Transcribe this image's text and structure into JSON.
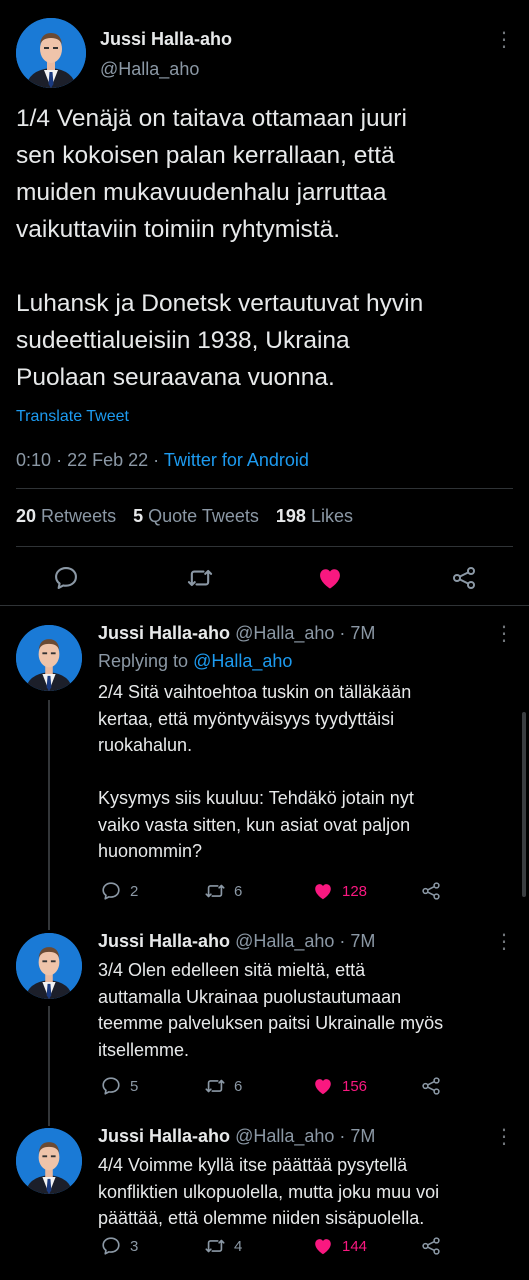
{
  "colors": {
    "background": "#000000",
    "accent": "#1d9bf0",
    "like": "#f91880",
    "muted": "#8b98a5"
  },
  "main_tweet": {
    "author_name": "Jussi Halla-aho",
    "author_handle": "@Halla_aho",
    "text": "1/4 Venäjä on taitava ottamaan juuri\nsen kokoisen palan kerrallaan, että\nmuiden mukavuudenhalu jarruttaa\nvaikuttaviin toimiin ryhtymistä.\n\nLuhansk ja Donetsk vertautuvat hyvin\nsudeettialueisiin 1938, Ukraina\nPuolaan seuraavana vuonna.",
    "translate_label": "Translate Tweet",
    "time": "0:10",
    "date": "22 Feb 22",
    "source": "Twitter for Android",
    "retweets_count": "20",
    "retweets_label": "Retweets",
    "quotes_count": "5",
    "quotes_label": "Quote Tweets",
    "likes_count": "198",
    "likes_label": "Likes",
    "actions": [
      "comment-icon",
      "retweet-icon",
      "like-icon",
      "share-icon"
    ]
  },
  "replies": [
    {
      "author_name": "Jussi Halla-aho",
      "author_handle": "@Halla_aho",
      "age": "· 7M",
      "replying_prefix": "Replying to",
      "replying_to": "@Halla_aho",
      "text": "2/4 Sitä vaihtoehtoa tuskin on tälläkään\nkertaa, että myöntyväisyys tyydyttäisi\nruokahalun.\n\nKysymys siis kuuluu: Tehdäkö jotain nyt\nvaiko vasta sitten, kun asiat ovat paljon\nhuonommin?",
      "replies": "2",
      "retweets": "6",
      "likes": "128"
    },
    {
      "author_name": "Jussi Halla-aho",
      "author_handle": "@Halla_aho",
      "age": "· 7M",
      "text": "3/4 Olen edelleen sitä mieltä, että\nauttamalla Ukrainaa puolustautumaan\nteemme palveluksen paitsi Ukrainalle myös\nitsellemme.",
      "replies": "5",
      "retweets": "6",
      "likes": "156"
    },
    {
      "author_name": "Jussi Halla-aho",
      "author_handle": "@Halla_aho",
      "age": "· 7M",
      "text": "4/4 Voimme kyllä itse päättää pysytellä\nkonfliktien ulkopuolella, mutta joku muu voi\npäättää, että olemme niiden sisäpuolella.",
      "replies": "3",
      "retweets": "4",
      "likes": "144"
    }
  ]
}
